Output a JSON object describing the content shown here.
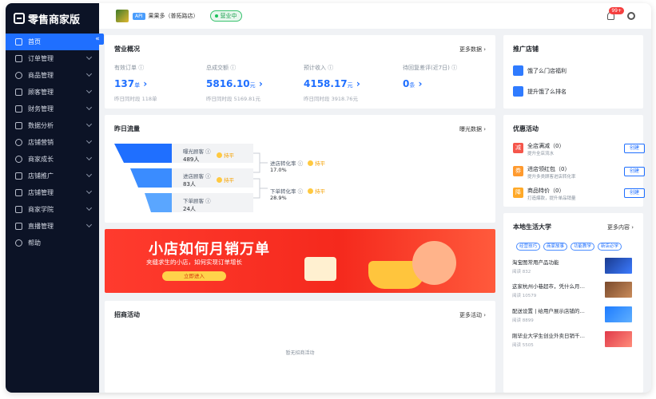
{
  "brand": {
    "name": "零售商家版"
  },
  "sidebar": {
    "items": [
      {
        "label": "首页",
        "active": true
      },
      {
        "label": "订单管理"
      },
      {
        "label": "商品管理"
      },
      {
        "label": "顾客管理"
      },
      {
        "label": "财务管理"
      },
      {
        "label": "数据分析"
      },
      {
        "label": "店铺营销"
      },
      {
        "label": "商家成长"
      },
      {
        "label": "店铺推广"
      },
      {
        "label": "店铺管理"
      },
      {
        "label": "商家学院"
      },
      {
        "label": "直播管理"
      },
      {
        "label": "帮助"
      }
    ]
  },
  "header": {
    "api_tag": "API",
    "store_name": "果果多（普拓路店）",
    "status": "营业中",
    "notification_count": "99+"
  },
  "overview": {
    "title": "营业概况",
    "more": "更多数据",
    "kpis": [
      {
        "label": "有效订单",
        "value": "137",
        "unit": "单",
        "sub": "昨日同时段 118单"
      },
      {
        "label": "总成交额",
        "value": "5816.10",
        "unit": "元",
        "sub": "昨日同时段 5169.81元"
      },
      {
        "label": "预计收入",
        "value": "4158.17",
        "unit": "元",
        "sub": "昨日同时段 3918.76元"
      },
      {
        "label": "待回复差评(近7日)",
        "value": "0",
        "unit": "条",
        "sub": ""
      }
    ]
  },
  "traffic": {
    "title": "昨日流量",
    "more": "曝光数据",
    "stages": [
      {
        "label": "曝光顾客",
        "value": "489人",
        "trend": "持平"
      },
      {
        "label": "进店顾客",
        "value": "83人",
        "trend": "持平"
      },
      {
        "label": "下单顾客",
        "value": "24人",
        "trend": ""
      }
    ],
    "rates": [
      {
        "label": "进店转化率",
        "value": "17.0%",
        "trend": "持平"
      },
      {
        "label": "下单转化率",
        "value": "28.9%",
        "trend": "持平"
      }
    ]
  },
  "banner": {
    "title": "小店如何月销万单",
    "subtitle": "夹缝求生的小店，如何实现订单增长",
    "button": "立即进入"
  },
  "recruit": {
    "title": "招商活动",
    "more": "更多活动",
    "empty": "暂无招商活动"
  },
  "promo": {
    "title": "推广店铺",
    "items": [
      {
        "label": "饿了么门店福利"
      },
      {
        "label": "提升饿了么排名"
      }
    ]
  },
  "discount": {
    "title": "优惠活动",
    "items": [
      {
        "icon_text": "减",
        "name": "全店满减（0）",
        "desc": "提升全店流水",
        "button": "创建",
        "color": "#f5564b"
      },
      {
        "icon_text": "券",
        "name": "进店领红包（0）",
        "desc": "提升多类顾客进店转化率",
        "button": "创建",
        "color": "#ff9a2e"
      },
      {
        "icon_text": "降",
        "name": "商品特价（0）",
        "desc": "打造爆款，提升单品销量",
        "button": "创建",
        "color": "#ffa928"
      }
    ]
  },
  "university": {
    "title": "本地生活大学",
    "more": "更多内容",
    "tags": [
      "经营技巧",
      "商家故事",
      "功能教学",
      "新店必学"
    ],
    "articles": [
      {
        "title": "淘宝图常用产品功能",
        "read": "阅读 832"
      },
      {
        "title": "这家杭州小巷超市，凭什么月…",
        "read": "阅读 10579"
      },
      {
        "title": "配送设置 | 给用户展示店铺的…",
        "read": "阅读 8899"
      },
      {
        "title": "刚毕业大学生创业外卖日销千…",
        "read": "阅读 5505"
      }
    ]
  }
}
